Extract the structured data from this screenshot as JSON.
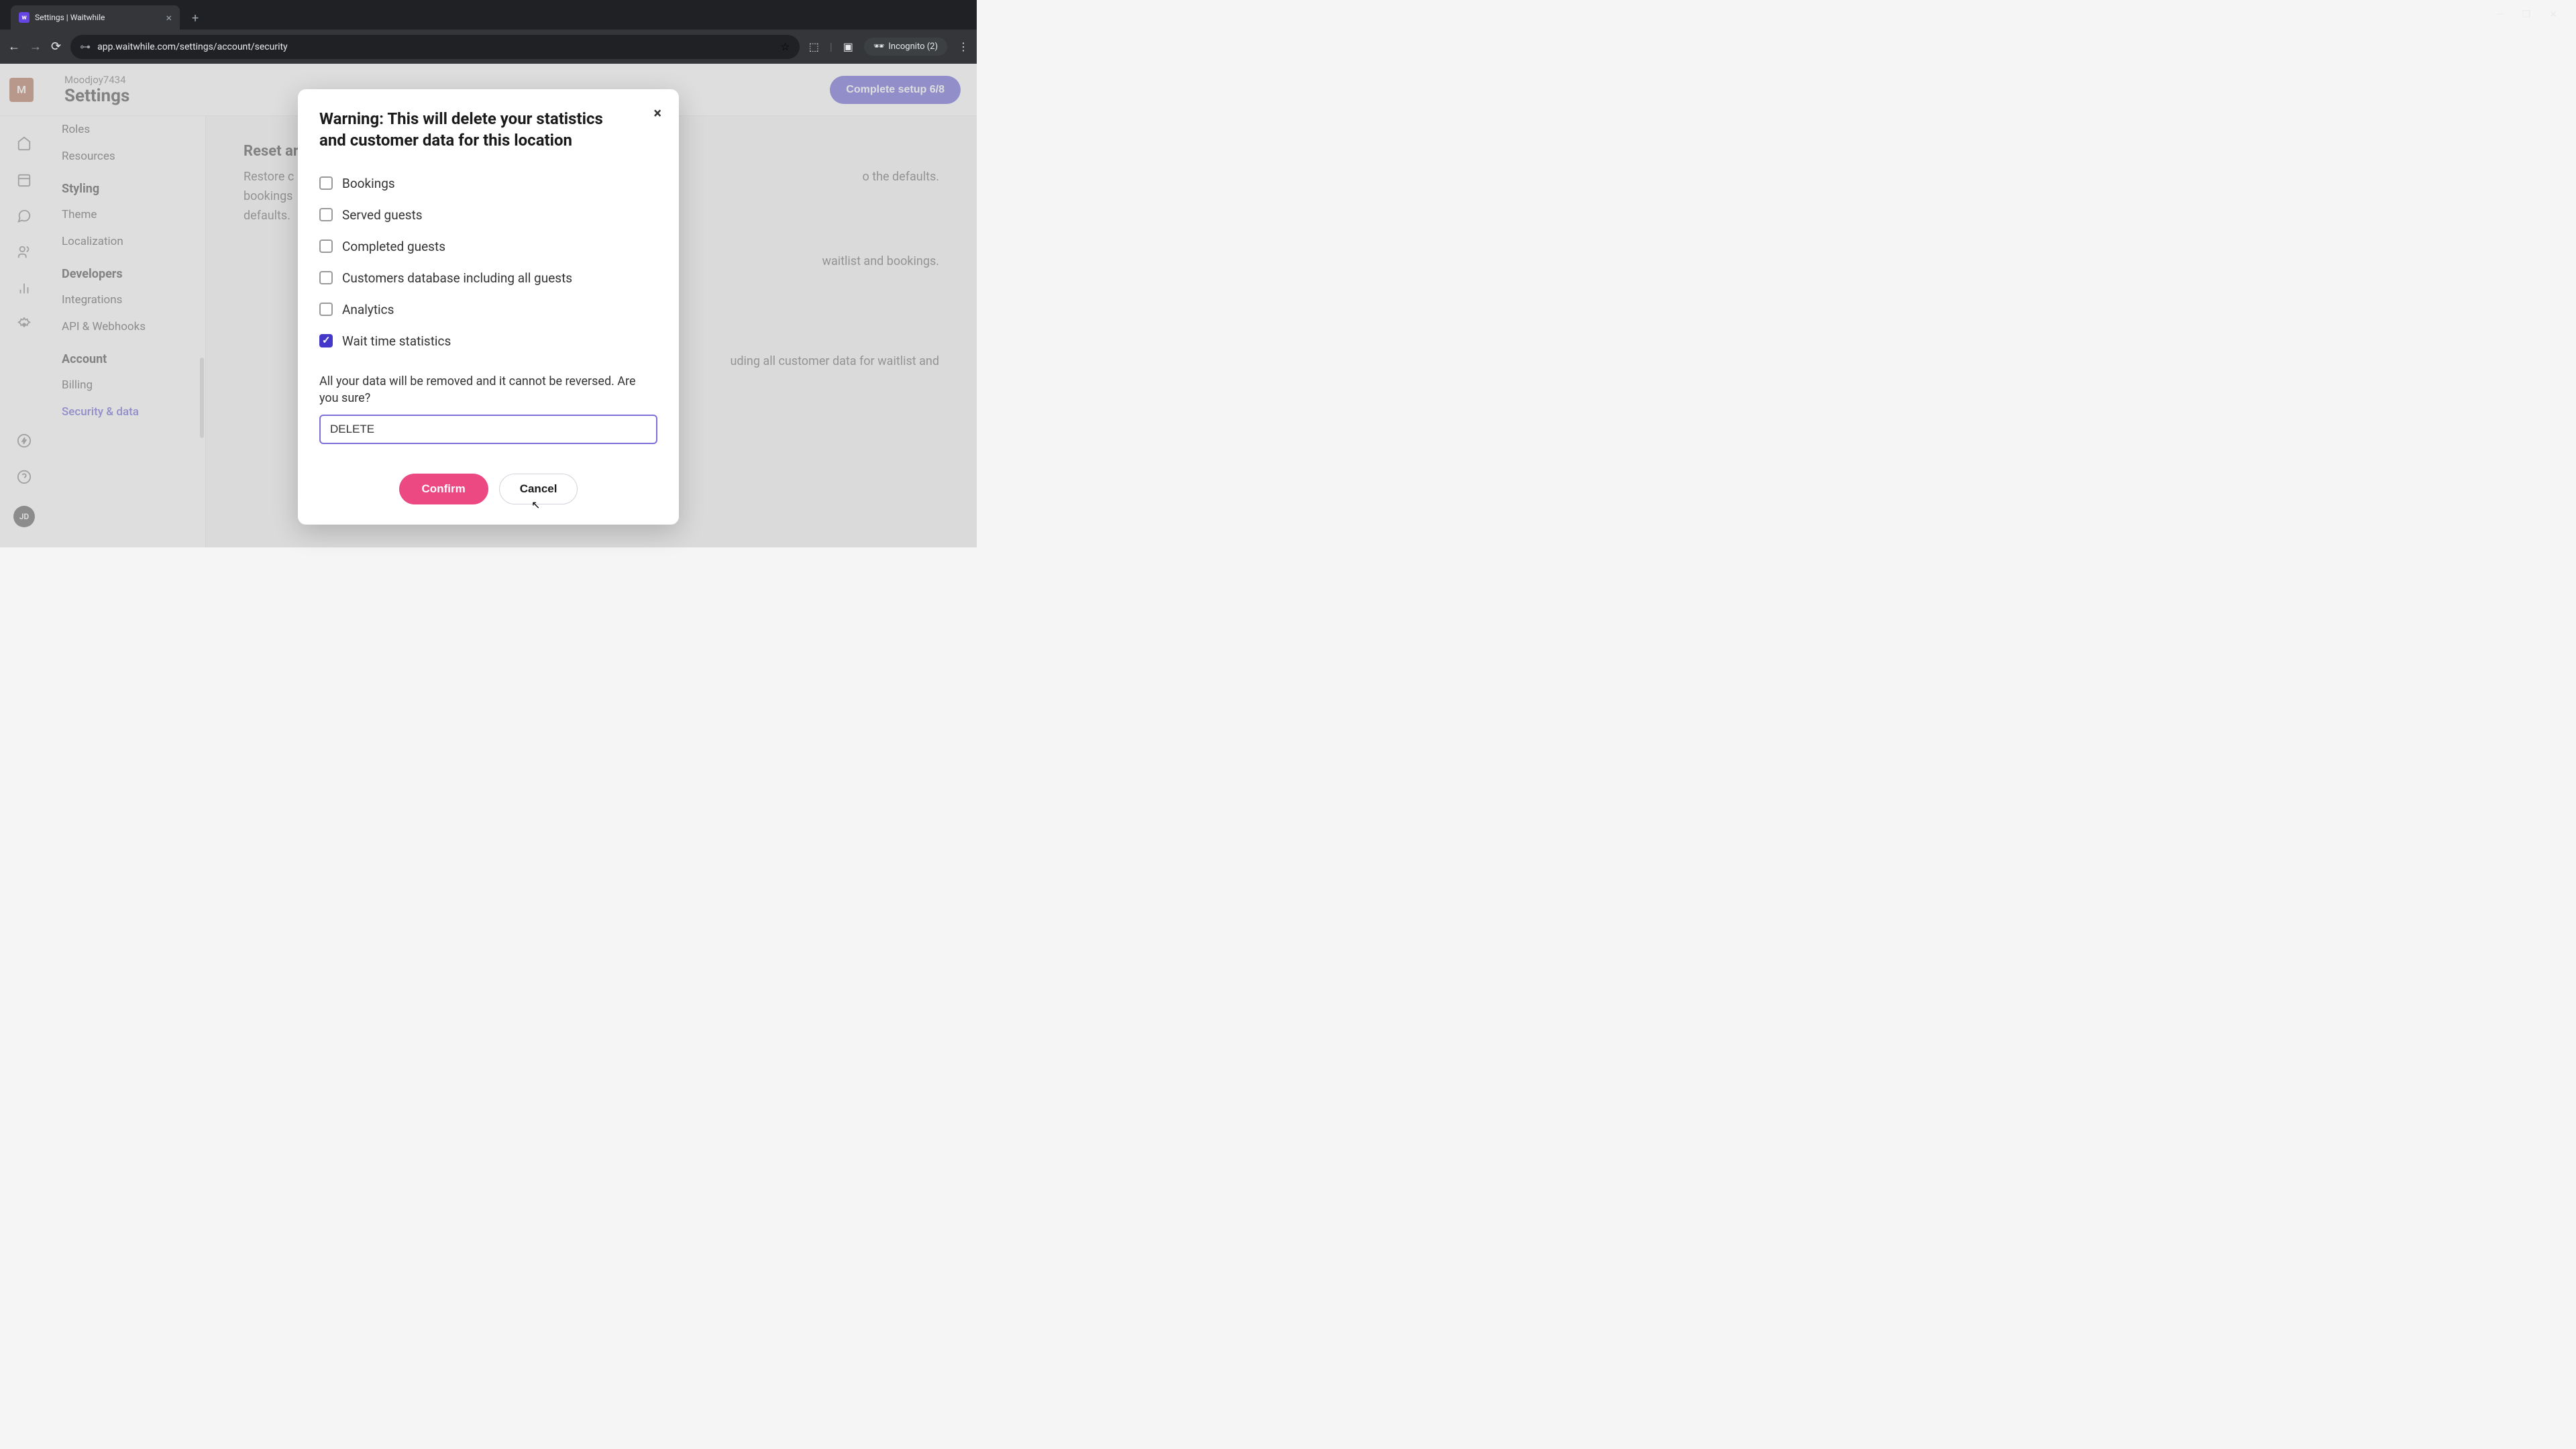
{
  "browser": {
    "tab_title": "Settings | Waitwhile",
    "url": "app.waitwhile.com/settings/account/security",
    "incognito_label": "Incognito (2)"
  },
  "header": {
    "avatar_letter": "M",
    "subtitle": "Moodjoy7434",
    "title": "Settings",
    "complete_setup": "Complete setup  6/8"
  },
  "sidebar": {
    "items": [
      {
        "label": "Roles",
        "type": "item"
      },
      {
        "label": "Resources",
        "type": "item"
      },
      {
        "label": "Styling",
        "type": "heading"
      },
      {
        "label": "Theme",
        "type": "item"
      },
      {
        "label": "Localization",
        "type": "item"
      },
      {
        "label": "Developers",
        "type": "heading"
      },
      {
        "label": "Integrations",
        "type": "item"
      },
      {
        "label": "API & Webhooks",
        "type": "item"
      },
      {
        "label": "Account",
        "type": "heading"
      },
      {
        "label": "Billing",
        "type": "item"
      },
      {
        "label": "Security & data",
        "type": "item",
        "active": true
      }
    ]
  },
  "rail_avatar": "JD",
  "main": {
    "section_title": "Reset ar",
    "desc1_a": "Restore c",
    "desc1_b": "o the defaults.",
    "desc2_a": "bookings",
    "desc3_a": "defaults.",
    "desc4_b": "waitlist and bookings.",
    "desc5_b": "uding all customer data for waitlist and"
  },
  "modal": {
    "title": "Warning: This will delete your statistics and customer data for this location",
    "checkboxes": [
      {
        "label": "Bookings",
        "checked": false
      },
      {
        "label": "Served guests",
        "checked": false
      },
      {
        "label": "Completed guests",
        "checked": false
      },
      {
        "label": "Customers database including all guests",
        "checked": false
      },
      {
        "label": "Analytics",
        "checked": false
      },
      {
        "label": "Wait time statistics",
        "checked": true
      }
    ],
    "warn_text": "All your data will be removed and it cannot be reversed. Are you sure?",
    "input_value": "DELETE",
    "confirm_label": "Confirm",
    "cancel_label": "Cancel"
  }
}
